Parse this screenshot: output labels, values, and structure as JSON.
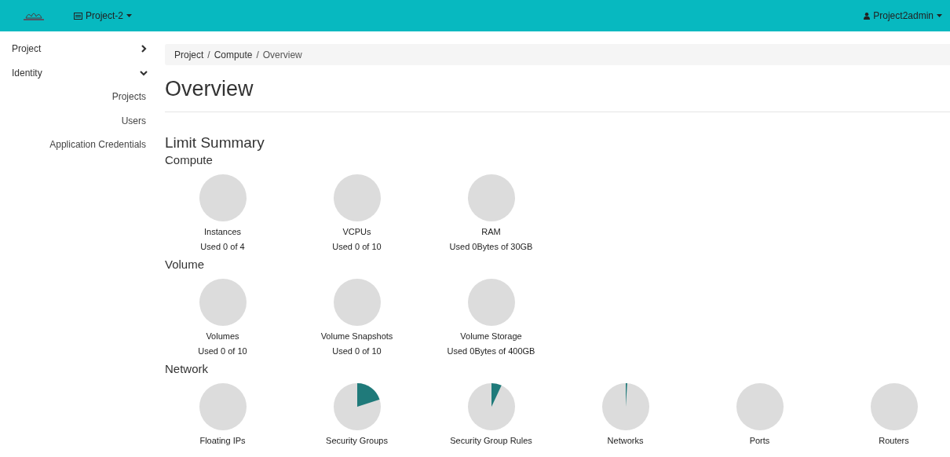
{
  "navbar": {
    "project_menu": "Project-2",
    "user_menu": "Project2admin"
  },
  "sidebar": {
    "items": [
      {
        "label": "Project",
        "expanded": false
      },
      {
        "label": "Identity",
        "expanded": true,
        "children": [
          {
            "label": "Projects"
          },
          {
            "label": "Users"
          },
          {
            "label": "Application Credentials"
          }
        ]
      }
    ]
  },
  "breadcrumb": [
    {
      "label": "Project",
      "separator": "/"
    },
    {
      "label": "Compute",
      "separator": "/"
    },
    {
      "label": "Overview"
    }
  ],
  "page_title": "Overview",
  "limit_summary": {
    "title": "Limit Summary",
    "groups": [
      {
        "title": "Compute",
        "items": [
          {
            "name": "Instances",
            "used": "Used 0 of 4",
            "kind": "empty"
          },
          {
            "name": "VCPUs",
            "used": "Used 0 of 10",
            "kind": "empty"
          },
          {
            "name": "RAM",
            "used": "Used 0Bytes of 30GB",
            "kind": "empty"
          }
        ]
      },
      {
        "title": "Volume",
        "items": [
          {
            "name": "Volumes",
            "used": "Used 0 of 10",
            "kind": "empty"
          },
          {
            "name": "Volume Snapshots",
            "used": "Used 0 of 10",
            "kind": "empty"
          },
          {
            "name": "Volume Storage",
            "used": "Used 0Bytes of 400GB",
            "kind": "empty"
          }
        ]
      },
      {
        "title": "Network",
        "items": [
          {
            "name": "Floating IPs",
            "kind": "empty"
          },
          {
            "name": "Security Groups",
            "kind": "wedge"
          },
          {
            "name": "Security Group Rules",
            "kind": "narrow"
          },
          {
            "name": "Networks",
            "kind": "sliver"
          },
          {
            "name": "Ports",
            "kind": "empty"
          },
          {
            "name": "Routers",
            "kind": "empty"
          }
        ]
      }
    ]
  }
}
